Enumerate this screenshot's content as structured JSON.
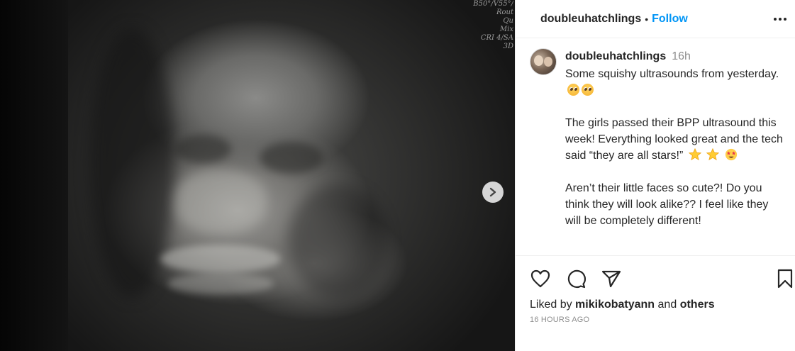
{
  "media": {
    "scan_info": [
      "B50°/V55°/",
      "Rout",
      "Qu",
      "Mix",
      "CRI 4/SA",
      "3D"
    ],
    "next_icon": "chevron-right-icon"
  },
  "header": {
    "username": "doubleuhatchlings",
    "separator": "•",
    "follow_label": "Follow",
    "more_icon": "more-horizontal-icon"
  },
  "caption": {
    "username": "doubleuhatchlings",
    "time_ago": "16h",
    "paragraphs": [
      "Some squishy ultrasounds from yesterday.",
      "The girls passed their BPP ultrasound this week! Everything looked great and the tech said “they are all stars!”",
      "Aren’t their little faces so cute?! Do you think they will look alike?? I feel like they will be completely different!"
    ],
    "emojis": {
      "p1": [
        "pleading-face",
        "pleading-face"
      ],
      "p2": [
        "star",
        "star",
        "star-struck"
      ]
    }
  },
  "actions": {
    "like_icon": "heart-icon",
    "comment_icon": "comment-icon",
    "share_icon": "send-icon",
    "save_icon": "bookmark-icon"
  },
  "likes": {
    "prefix": "Liked by",
    "user": "mikikobatyann",
    "joiner": "and",
    "others": "others"
  },
  "timestamp": "16 HOURS AGO",
  "colors": {
    "accent": "#0095f6",
    "text": "#262626",
    "muted": "#8e8e8e",
    "border": "#efefef"
  }
}
